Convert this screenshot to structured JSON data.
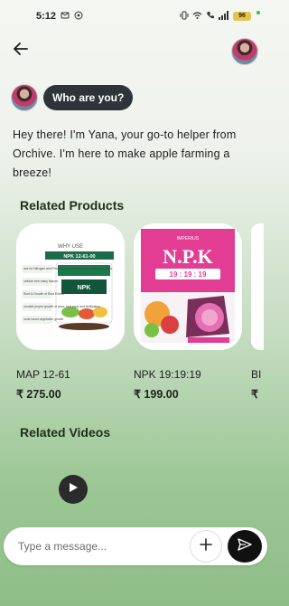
{
  "status_bar": {
    "time": "5:12",
    "battery": "96",
    "signal_text": "☰",
    "icons": [
      "message-icon",
      "whatsapp-icon",
      "vibrate-icon",
      "wifi-icon",
      "call-icon",
      "signal-icon"
    ]
  },
  "header": {
    "back_icon": "arrow-left-icon",
    "avatar_icon": "user-avatar"
  },
  "chat": {
    "user_question": "Who are you?",
    "bot_reply": "Hey there! I'm Yana, your go-to helper from Orchive. I'm here to make apple farming a breeze!"
  },
  "related_products": {
    "title": "Related Products",
    "items": [
      {
        "name": "MAP 12-61",
        "price": "₹ 275.00",
        "image": {
          "header": "WHY USE",
          "product_label": "NPK 12-61-00",
          "bullets": [
            "ace for Nitrogen and Phosphorus a deficiency in plants and crops.",
            "cefuliar tree many factors",
            "Root & Growth of Root Enters",
            "omoted proper growth of ance, root pans and fertilization",
            "mote boost vegetative growth"
          ]
        }
      },
      {
        "name": "NPK 19:19:19",
        "price": "₹ 199.00",
        "image": {
          "brand": "IMPERIUS",
          "title": "N.P.K",
          "grade": "19 : 19 : 19"
        }
      },
      {
        "name": "BI",
        "price": "₹"
      }
    ]
  },
  "related_videos": {
    "title": "Related Videos",
    "play_icon": "play-icon"
  },
  "composer": {
    "placeholder": "Type a message...",
    "add_icon": "plus-icon",
    "send_icon": "send-icon"
  },
  "colors": {
    "chip_bg": "#2f3438",
    "send_bg": "#111111",
    "gradient_bottom": "#8fbd88",
    "npk_pink": "#e23c93"
  }
}
